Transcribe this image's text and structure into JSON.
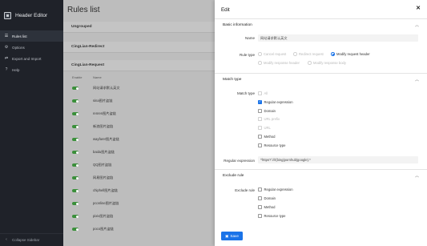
{
  "app": {
    "title": "Header Editor"
  },
  "sidebar": {
    "items": [
      {
        "label": "Rules list",
        "icon": "list-icon"
      },
      {
        "label": "Options",
        "icon": "gear-icon"
      },
      {
        "label": "Export and Import",
        "icon": "swap-icon"
      },
      {
        "label": "Help",
        "icon": "help-icon"
      }
    ],
    "collapse_label": "Collapse Sidebar"
  },
  "main": {
    "title": "Rules list",
    "groups": [
      "Ungrouped",
      "CingLian-Redirect",
      "CingLian-Request"
    ],
    "columns": {
      "enable": "Enable",
      "name": "Name"
    },
    "rows": [
      "网站请求默认英文",
      "sina图片盗链",
      "renren图片盗链",
      "新浪图片盗链",
      "wayfarer图片盗链",
      "baidu图片盗链",
      "QQ图片盗链",
      "网易图片盗链",
      "chiphell图片盗链",
      "pconline图片盗链",
      "pixiv图片盗链",
      "poco图片盗链"
    ]
  },
  "drawer": {
    "title": "Edit",
    "basic": {
      "section_title": "Basic information",
      "name_label": "Name",
      "name_value": "网站请求默认英文",
      "rule_type_label": "Rule type",
      "rule_types": [
        {
          "label": "Cancel request",
          "selected": false
        },
        {
          "label": "Redirect request",
          "selected": false
        },
        {
          "label": "Modify request header",
          "selected": true
        },
        {
          "label": "Modify response header",
          "selected": false
        },
        {
          "label": "Modify response body",
          "selected": false
        }
      ]
    },
    "match": {
      "section_title": "Match type",
      "match_type_label": "Match type",
      "options": [
        {
          "label": "All",
          "checked": false,
          "disabled": true
        },
        {
          "label": "Regular expression",
          "checked": true,
          "disabled": false
        },
        {
          "label": "Domain",
          "checked": false,
          "disabled": false
        },
        {
          "label": "URL prefix",
          "checked": false,
          "disabled": true
        },
        {
          "label": "URL",
          "checked": false,
          "disabled": true
        },
        {
          "label": "Method",
          "checked": false,
          "disabled": false
        },
        {
          "label": "Resource type",
          "checked": false,
          "disabled": false
        }
      ],
      "regex_label": "Regular expression",
      "regex_value": "^https?:\\/\\/(bing|pornhub|google).*"
    },
    "exclude": {
      "section_title": "Exclude rule",
      "exclude_label": "Exclude rule",
      "options": [
        {
          "label": "Regular expression",
          "checked": false
        },
        {
          "label": "Domain",
          "checked": false
        },
        {
          "label": "Method",
          "checked": false
        },
        {
          "label": "Resource type",
          "checked": false
        }
      ]
    },
    "save_label": "Save"
  },
  "colors": {
    "sidebar_bg": "#1f2229",
    "accent": "#1a73e8",
    "toggle_on": "#3a8f3a",
    "overlay_bg": "#bdbdbd"
  }
}
